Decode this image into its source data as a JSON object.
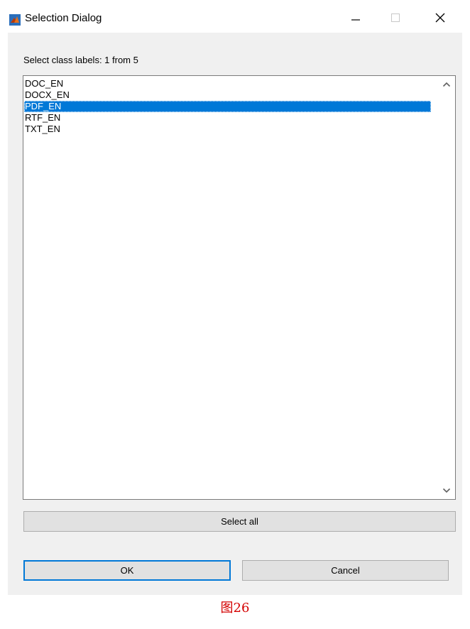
{
  "window": {
    "title": "Selection Dialog",
    "icon": "matlab-icon",
    "controls": {
      "minimize": "minimize-icon",
      "maximize": "maximize-icon",
      "close": "close-icon"
    }
  },
  "prompt": "Select class labels: 1 from 5",
  "list": {
    "items": [
      "DOC_EN",
      "DOCX_EN",
      "PDF_EN",
      "RTF_EN",
      "TXT_EN"
    ],
    "selected_index": 2
  },
  "buttons": {
    "select_all": "Select all",
    "ok": "OK",
    "cancel": "Cancel"
  },
  "caption": "图26",
  "colors": {
    "selection": "#0078d7",
    "caption": "#d40000"
  }
}
